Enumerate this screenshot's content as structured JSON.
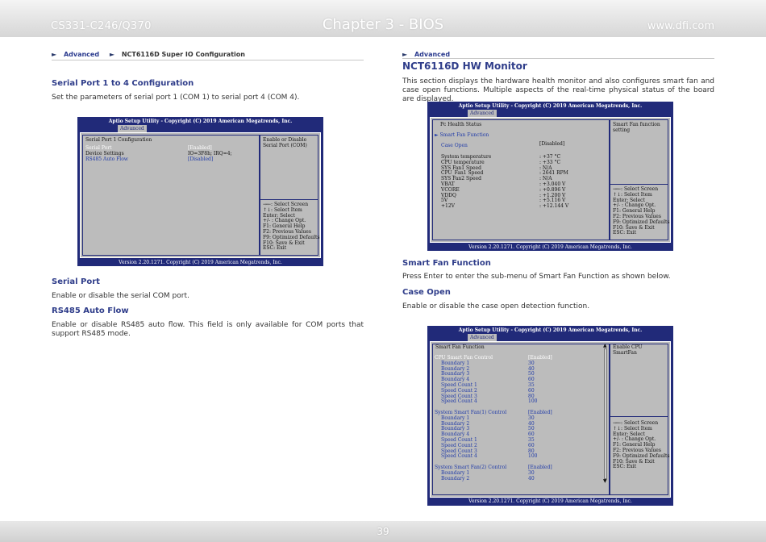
{
  "header": {
    "left": "CS331-C246/Q370",
    "center": "Chapter 3 - BIOS",
    "right": "www.dfi.com"
  },
  "footer": {
    "page": "39"
  },
  "left": {
    "breadcrumb": {
      "arrow": "►",
      "item1": "Advanced",
      "item2": "NCT6116D Super IO Configuration"
    },
    "section_title": "Serial Port 1 to 4 Configuration",
    "section_text": "Set the parameters of serial port 1 (COM 1) to serial port 4 (COM 4).",
    "serial_port_title": "Serial Port",
    "serial_port_text": "Enable or disable the serial COM port.",
    "rs485_title": "RS485 Auto Flow",
    "rs485_text": "Enable or disable RS485 auto flow. This field is only available for COM ports that support RS485 mode."
  },
  "right": {
    "breadcrumb": {
      "arrow": "►",
      "item1": "Advanced"
    },
    "title": "NCT6116D HW Monitor",
    "intro": "This section displays the hardware health monitor and also configures smart fan and case open functions. Multiple aspects of the real-time physical status of the board are displayed.",
    "smart_fan_title": "Smart Fan Function",
    "smart_fan_text": "Press Enter to enter the sub-menu of Smart Fan Function as shown below.",
    "case_open_title": "Case Open",
    "case_open_text": "Enable or disable the case open detection function."
  },
  "bios_common": {
    "title": "Aptio Setup Utility - Copyright (C) 2019 American Megatrends, Inc.",
    "tab": "Advanced",
    "footer": "Version 2.20.1271. Copyright (C) 2019 American Megatrends, Inc.",
    "keys": [
      "→←: Select Screen",
      "↑↓: Select Item",
      "Enter: Select",
      "+/- : Change Opt.",
      "F1: General Help",
      "F2: Previous Values",
      "F9: Optimized Defaults",
      "F10: Save & Exit",
      "ESC: Exit"
    ]
  },
  "bios1": {
    "heading": "Serial Port 1 Configuration",
    "help": "Enable or Disable Serial Port (COM)",
    "rows": [
      {
        "label": "Serial Port",
        "value": "[Enabled]",
        "style": "white"
      },
      {
        "label": "Device Settings",
        "value": "IO=3F8h; IRQ=4;",
        "style": "normal"
      },
      {
        "label": "RS485 Auto Flow",
        "value": "[Disabled]",
        "style": "blue"
      }
    ]
  },
  "bios2": {
    "heading": "Pc Health Status",
    "submenu": "► Smart Fan Function",
    "case_open": {
      "label": "Case Open",
      "value": "[Disabled]"
    },
    "help": "Smart Fan function setting",
    "readings": [
      {
        "label": "System temperature",
        "value": ": +37 °C"
      },
      {
        "label": "CPU temperature",
        "value": ": +33 °C"
      },
      {
        "label": "SYS Fan1 Speed",
        "value": ": N/A"
      },
      {
        "label": "CPU_Fan1 Speed",
        "value": ": 2641 RPM"
      },
      {
        "label": "SYS Fan2 Speed",
        "value": ": N/A"
      },
      {
        "label": "VBAT",
        "value": ": +3.040 V"
      },
      {
        "label": "VCORE",
        "value": ": +0.896 V"
      },
      {
        "label": "VDDQ",
        "value": ": +1.200 V"
      },
      {
        "label": "5V",
        "value": ": +5.116 V"
      },
      {
        "label": "+12V",
        "value": ": +12.144 V"
      }
    ]
  },
  "bios3": {
    "heading": "Smart Fan Function",
    "help": "Enable CPU SmartFan",
    "rows": [
      {
        "label": "CPU Smart Fan Control",
        "value": "[Enabled]",
        "indent": 0,
        "style": "white"
      },
      {
        "label": "Boundary 1",
        "value": "30",
        "indent": 1,
        "style": "blue"
      },
      {
        "label": "Boundary 2",
        "value": "40",
        "indent": 1,
        "style": "blue"
      },
      {
        "label": "Boundary 3",
        "value": "50",
        "indent": 1,
        "style": "blue"
      },
      {
        "label": "Boundary 4",
        "value": "60",
        "indent": 1,
        "style": "blue"
      },
      {
        "label": "Speed Count 1",
        "value": "35",
        "indent": 1,
        "style": "blue"
      },
      {
        "label": "Speed Count 2",
        "value": "60",
        "indent": 1,
        "style": "blue"
      },
      {
        "label": "Speed Count 3",
        "value": "80",
        "indent": 1,
        "style": "blue"
      },
      {
        "label": "Speed Count 4",
        "value": "100",
        "indent": 1,
        "style": "blue"
      },
      {
        "label": "",
        "value": "",
        "indent": 0,
        "style": "blue"
      },
      {
        "label": "System Smart Fan(1) Control",
        "value": "[Enabled]",
        "indent": 0,
        "style": "blue"
      },
      {
        "label": "Boundary 1",
        "value": "30",
        "indent": 1,
        "style": "blue"
      },
      {
        "label": "Boundary 2",
        "value": "40",
        "indent": 1,
        "style": "blue"
      },
      {
        "label": "Boundary 3",
        "value": "50",
        "indent": 1,
        "style": "blue"
      },
      {
        "label": "Boundary 4",
        "value": "60",
        "indent": 1,
        "style": "blue"
      },
      {
        "label": "Speed Count 1",
        "value": "35",
        "indent": 1,
        "style": "blue"
      },
      {
        "label": "Speed Count 2",
        "value": "60",
        "indent": 1,
        "style": "blue"
      },
      {
        "label": "Speed Count 3",
        "value": "80",
        "indent": 1,
        "style": "blue"
      },
      {
        "label": "Speed Count 4",
        "value": "100",
        "indent": 1,
        "style": "blue"
      },
      {
        "label": "",
        "value": "",
        "indent": 0,
        "style": "blue"
      },
      {
        "label": "System Smart Fan(2) Control",
        "value": "[Enabled]",
        "indent": 0,
        "style": "blue"
      },
      {
        "label": "Boundary 1",
        "value": "30",
        "indent": 1,
        "style": "blue"
      },
      {
        "label": "Boundary 2",
        "value": "40",
        "indent": 1,
        "style": "blue"
      }
    ]
  }
}
